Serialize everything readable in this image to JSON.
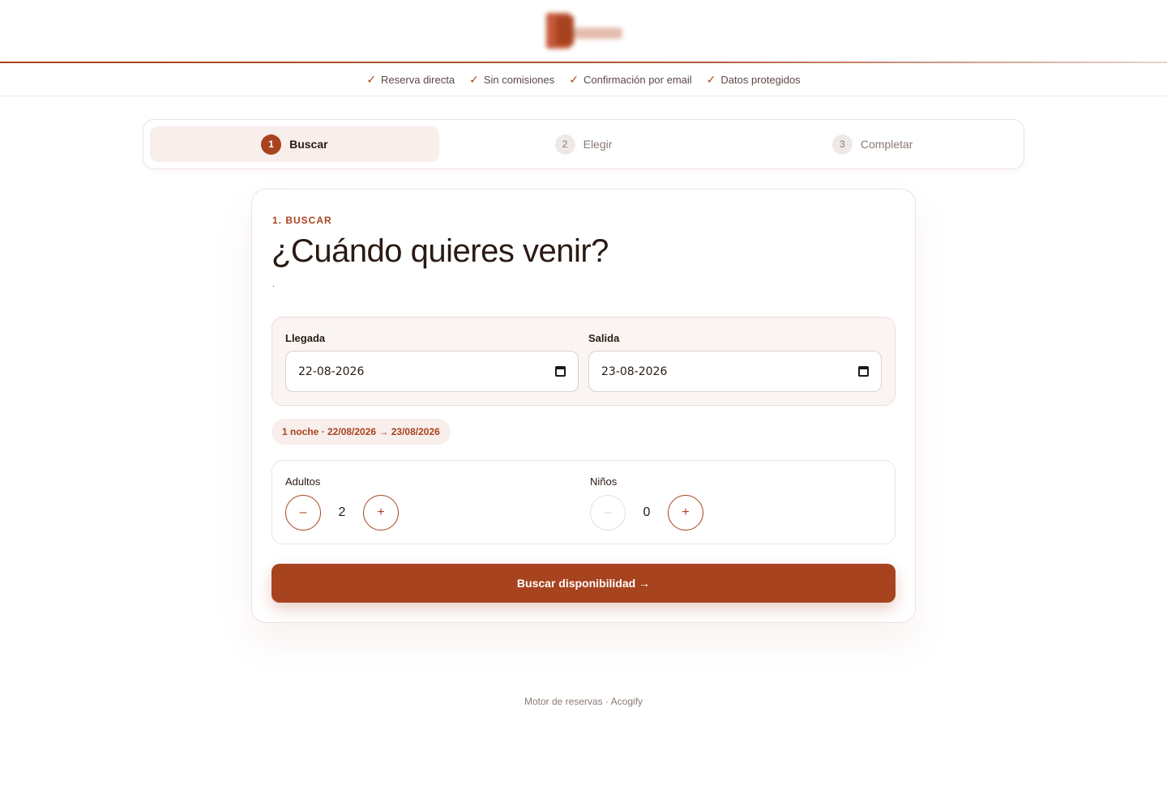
{
  "header": {
    "logo_icon": "brand-logo",
    "accent_color": "#a8431f"
  },
  "trust": {
    "check_glyph": "✓",
    "items": [
      "Reserva directa",
      "Sin comisiones",
      "Confirmación por email",
      "Datos protegidos"
    ]
  },
  "stepper": {
    "steps": [
      {
        "num": "1",
        "label": "Buscar",
        "active": true
      },
      {
        "num": "2",
        "label": "Elegir",
        "active": false
      },
      {
        "num": "3",
        "label": "Completar",
        "active": false
      }
    ]
  },
  "search": {
    "eyebrow": "1. BUSCAR",
    "title": "¿Cuándo quieres venir?",
    "subtitle": ".",
    "arrival_label": "Llegada",
    "arrival_value": "22-08-2026",
    "departure_label": "Salida",
    "departure_value": "23-08-2026",
    "nights_summary": "1 noche · 22/08/2026 → 23/08/2026",
    "adults_label": "Adultos",
    "adults_value": "2",
    "children_label": "Niños",
    "children_value": "0",
    "minus_glyph": "–",
    "plus_glyph": "+",
    "submit_label": "Buscar disponibilidad →"
  },
  "footer": {
    "text": "Motor de reservas · Acogify"
  }
}
